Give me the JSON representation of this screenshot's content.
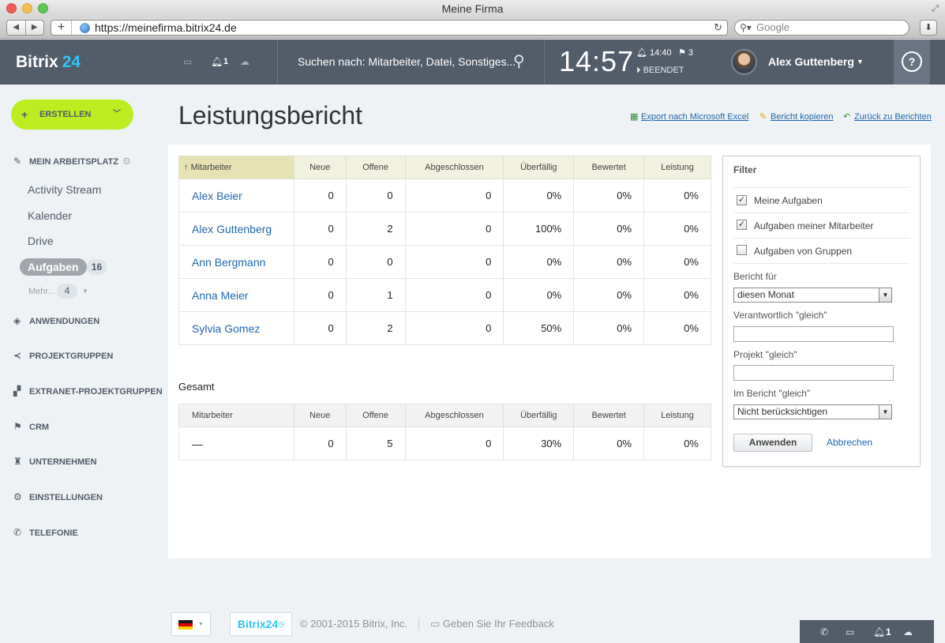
{
  "browser": {
    "window_title": "Meine Firma",
    "url": "https://meinefirma.bitrix24.de",
    "search_placeholder": "Google"
  },
  "header": {
    "logo_text": "Bitrix",
    "logo_num": "24",
    "notification_count": "1",
    "search_placeholder": "Suchen nach: Mitarbeiter, Datei, Sonstiges...",
    "clock": "14:57",
    "alarm_time": "14:40",
    "flag_count": "3",
    "workday_status": "BEENDET",
    "user_name": "Alex Guttenberg",
    "help_label": "?"
  },
  "sidebar": {
    "create_label": "ERSTELLEN",
    "workspace_label": "MEIN ARBEITSPLATZ",
    "items": [
      {
        "label": "Activity Stream"
      },
      {
        "label": "Kalender"
      },
      {
        "label": "Drive"
      }
    ],
    "active_item": {
      "label": "Aufgaben",
      "badge": "16"
    },
    "more": {
      "label": "Mehr...",
      "badge": "4"
    },
    "sections": [
      {
        "label": "ANWENDUNGEN",
        "icon": "cube-icon"
      },
      {
        "label": "PROJEKTGRUPPEN",
        "icon": "share-icon"
      },
      {
        "label": "EXTRANET-PROJEKTGRUPPEN",
        "icon": "blocks-icon"
      },
      {
        "label": "CRM",
        "icon": "flag-icon"
      },
      {
        "label": "UNTERNEHMEN",
        "icon": "castle-icon"
      },
      {
        "label": "EINSTELLUNGEN",
        "icon": "gear-icon"
      },
      {
        "label": "TELEFONIE",
        "icon": "phone-icon"
      }
    ]
  },
  "page": {
    "title": "Leistungsbericht",
    "links": {
      "export": "Export nach Microsoft Excel",
      "copy": "Bericht kopieren",
      "back": "Zurück zu Berichten"
    }
  },
  "report": {
    "sort_arrow": "↑",
    "headers": [
      "Mitarbeiter",
      "Neue",
      "Offene",
      "Abgeschlossen",
      "Überfällig",
      "Bewertet",
      "Leistung"
    ],
    "rows": [
      {
        "name": "Alex Beier",
        "neue": "0",
        "offene": "0",
        "abgeschlossen": "0",
        "ueberfaellig": "0%",
        "bewertet": "0%",
        "leistung": "0%"
      },
      {
        "name": "Alex Guttenberg",
        "neue": "0",
        "offene": "2",
        "abgeschlossen": "0",
        "ueberfaellig": "100%",
        "bewertet": "0%",
        "leistung": "0%"
      },
      {
        "name": "Ann Bergmann",
        "neue": "0",
        "offene": "0",
        "abgeschlossen": "0",
        "ueberfaellig": "0%",
        "bewertet": "0%",
        "leistung": "0%"
      },
      {
        "name": "Anna Meier",
        "neue": "0",
        "offene": "1",
        "abgeschlossen": "0",
        "ueberfaellig": "0%",
        "bewertet": "0%",
        "leistung": "0%"
      },
      {
        "name": "Sylvia Gomez",
        "neue": "0",
        "offene": "2",
        "abgeschlossen": "0",
        "ueberfaellig": "50%",
        "bewertet": "0%",
        "leistung": "0%"
      }
    ],
    "totals_title": "Gesamt",
    "totals": {
      "name": "—",
      "neue": "0",
      "offene": "5",
      "abgeschlossen": "0",
      "ueberfaellig": "30%",
      "bewertet": "0%",
      "leistung": "0%"
    }
  },
  "filter": {
    "title": "Filter",
    "checkboxes": [
      {
        "label": "Meine Aufgaben",
        "checked": true,
        "mark": "✓"
      },
      {
        "label": "Aufgaben meiner Mitarbeiter",
        "checked": true,
        "mark": "✓"
      },
      {
        "label": "Aufgaben von Gruppen",
        "checked": false,
        "mark": ""
      }
    ],
    "bericht_fuer_label": "Bericht für",
    "bericht_fuer_value": "diesen Monat",
    "verantwortlich_label": "Verantwortlich \"gleich\"",
    "verantwortlich_value": "",
    "projekt_label": "Projekt \"gleich\"",
    "projekt_value": "",
    "im_bericht_label": "Im Bericht \"gleich\"",
    "im_bericht_value": "Nicht berücksichtigen",
    "apply_label": "Anwenden",
    "cancel_label": "Abbrechen"
  },
  "footer": {
    "logo": "Bitrix24",
    "copyright": "© 2001-2015 Bitrix, Inc.",
    "feedback": "Geben Sie Ihr Feedback",
    "notification_count": "1"
  },
  "colors": {
    "header_bg": "#535c69",
    "accent_blue": "#2fc6f6",
    "create_btn": "#bbed21",
    "link": "#2067b0"
  }
}
